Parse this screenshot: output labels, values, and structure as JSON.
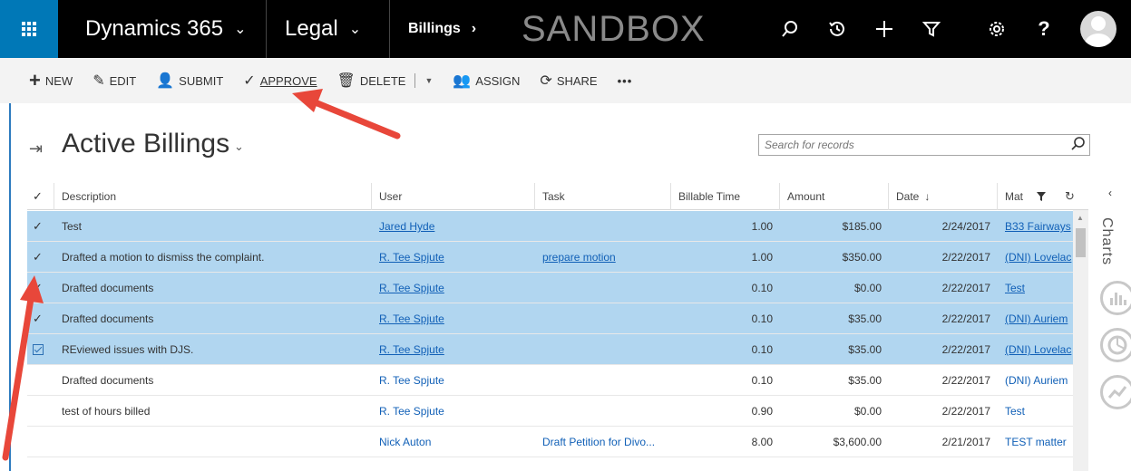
{
  "topnav": {
    "app_name": "Dynamics 365",
    "area": "Legal",
    "entity": "Billings",
    "environment": "SANDBOX",
    "icons": [
      "search-icon",
      "history-icon",
      "plus-icon",
      "filter-icon",
      "gear-icon",
      "help-icon"
    ],
    "help_label": "?"
  },
  "commandbar": {
    "new_label": "NEW",
    "edit_label": "EDIT",
    "submit_label": "SUBMIT",
    "approve_label": "APPROVE",
    "delete_label": "DELETE",
    "assign_label": "ASSIGN",
    "share_label": "SHARE",
    "more_label": "•••"
  },
  "view": {
    "title": "Active Billings",
    "search_placeholder": "Search for records"
  },
  "grid": {
    "columns": {
      "description": "Description",
      "user": "User",
      "task": "Task",
      "billable_time": "Billable Time",
      "amount": "Amount",
      "date": "Date",
      "matter": "Mat"
    },
    "rows": [
      {
        "selected": true,
        "check": "✓",
        "description": "Test",
        "user": "Jared Hyde",
        "task": "",
        "billable_time": "1.00",
        "amount": "$185.00",
        "date": "2/24/2017",
        "matter": "B33 Fairways"
      },
      {
        "selected": true,
        "check": "✓",
        "description": "Drafted a motion to dismiss the complaint.",
        "user": "R. Tee Spjute",
        "task": "prepare motion",
        "billable_time": "1.00",
        "amount": "$350.00",
        "date": "2/22/2017",
        "matter": "(DNI) Lovelac"
      },
      {
        "selected": true,
        "check": "✓",
        "description": "Drafted documents",
        "user": "R. Tee Spjute",
        "task": "",
        "billable_time": "0.10",
        "amount": "$0.00",
        "date": "2/22/2017",
        "matter": "Test"
      },
      {
        "selected": true,
        "check": "✓",
        "description": "Drafted documents",
        "user": "R. Tee Spjute",
        "task": "",
        "billable_time": "0.10",
        "amount": "$35.00",
        "date": "2/22/2017",
        "matter": "(DNI) Auriem"
      },
      {
        "selected": true,
        "check": "box",
        "description": "REviewed issues with DJS.",
        "user": "R. Tee Spjute",
        "task": "",
        "billable_time": "0.10",
        "amount": "$35.00",
        "date": "2/22/2017",
        "matter": "(DNI) Lovelac"
      },
      {
        "selected": false,
        "check": "",
        "description": "Drafted documents",
        "user": "R. Tee Spjute",
        "task": "",
        "billable_time": "0.10",
        "amount": "$35.00",
        "date": "2/22/2017",
        "matter": "(DNI) Auriem"
      },
      {
        "selected": false,
        "check": "",
        "description": "test of hours billed",
        "user": "R. Tee Spjute",
        "task": "",
        "billable_time": "0.90",
        "amount": "$0.00",
        "date": "2/22/2017",
        "matter": "Test"
      },
      {
        "selected": false,
        "check": "",
        "description": "",
        "user": "Nick Auton",
        "task": "Draft Petition for Divo...",
        "billable_time": "8.00",
        "amount": "$3,600.00",
        "date": "2/21/2017",
        "matter": "TEST matter"
      }
    ]
  },
  "charts_pane": {
    "label": "Charts",
    "icons": [
      "bar-chart-icon",
      "pie-chart-icon",
      "line-chart-icon"
    ]
  },
  "colors": {
    "topbar": "#000000",
    "waffle": "#0078b7",
    "selected_row": "#b1d6f0",
    "link": "#1160b7",
    "annotation_arrow": "#e8473a"
  }
}
